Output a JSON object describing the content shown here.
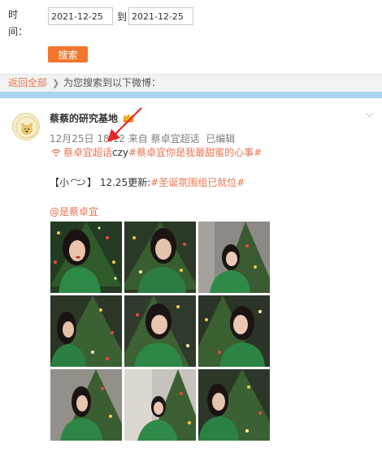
{
  "search_form": {
    "time_label": "时\n间：",
    "time_label_line1": "时",
    "time_label_line2": "间：",
    "date_from": "2021-12-25",
    "to_label": "到",
    "date_to": "2021-12-25",
    "search_button": "搜索"
  },
  "result_bar": {
    "back_link": "返回全部",
    "separator_icon": "chevron-right-icon",
    "result_text": "为您搜索到以下微博："
  },
  "post": {
    "username": "蔡蔡的研究基地",
    "vip_icon": "crown-icon",
    "timestamp": "12月25日 18:12",
    "source_prefix": "来自",
    "source": "蔡卓宜超话",
    "edited": "已编辑",
    "topic_icon": "supertopic-icon",
    "supertopic": "蔡卓宜超话",
    "supertopic_suffix": "czy",
    "hashtag_1": "#蔡卓宜你是我最甜蜜的心事#",
    "update_prefix": "【小",
    "update_emoji": "emoji-icon",
    "update_bracket": "】",
    "update_text": " 12.25更新:",
    "hashtag_2": "#圣诞氛围组已就位#",
    "mention": "@是蔡卓宜",
    "menu_icon": "chevron-down-icon",
    "annotation": "red-arrow-icon",
    "photos": [
      {
        "name": "photo-1",
        "scene": "christmas-tree-portrait"
      },
      {
        "name": "photo-2",
        "scene": "christmas-tree-portrait"
      },
      {
        "name": "photo-3",
        "scene": "christmas-tree-portrait"
      },
      {
        "name": "photo-4",
        "scene": "christmas-tree-portrait"
      },
      {
        "name": "photo-5",
        "scene": "christmas-tree-portrait"
      },
      {
        "name": "photo-6",
        "scene": "christmas-tree-portrait"
      },
      {
        "name": "photo-7",
        "scene": "christmas-tree-portrait"
      },
      {
        "name": "photo-8",
        "scene": "christmas-tree-portrait"
      },
      {
        "name": "photo-9",
        "scene": "christmas-tree-portrait"
      }
    ]
  },
  "colors": {
    "accent_orange": "#f0772d",
    "link_orange": "#eb7350",
    "blue_bar": "#aad4f0",
    "annotation_red": "#e3242b"
  }
}
